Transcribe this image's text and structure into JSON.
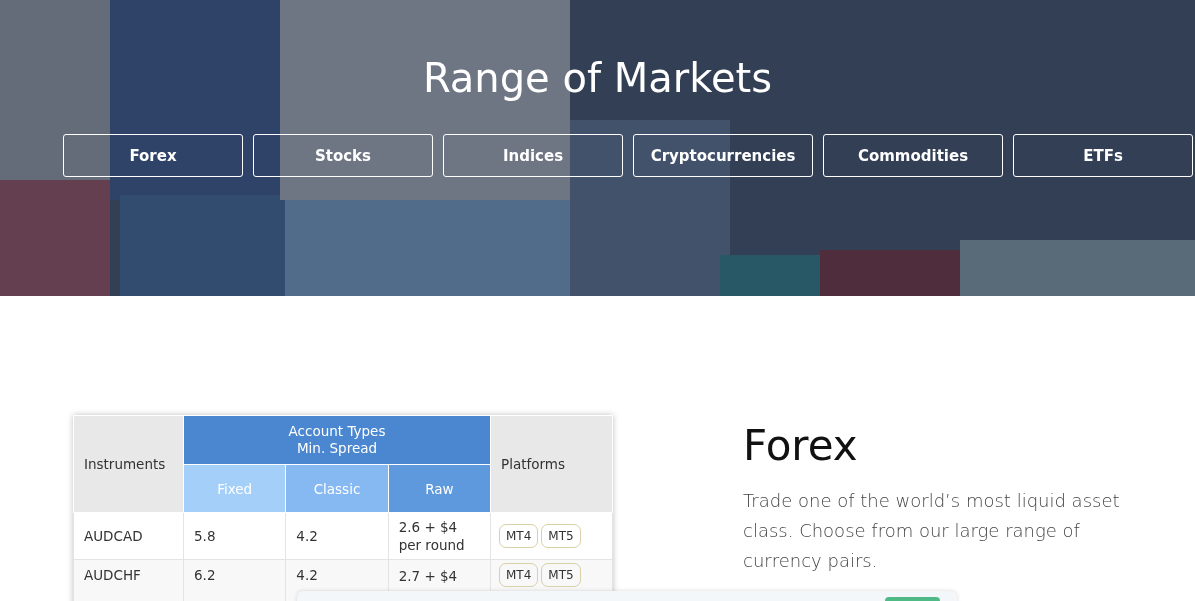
{
  "hero": {
    "kind": "picture",
    "title": "Range of Markets",
    "tabs": [
      {
        "label": "Forex"
      },
      {
        "label": "Stocks"
      },
      {
        "label": "Indices"
      },
      {
        "label": "Cryptocurrencies"
      },
      {
        "label": "Commodities"
      },
      {
        "label": "ETFs"
      }
    ]
  },
  "table": {
    "columns": {
      "instrument": "Instruments",
      "group": "Account Types\nMin. Spread",
      "sub": [
        "Fixed",
        "Classic",
        "Raw"
      ],
      "platforms": "Platforms"
    },
    "rows": [
      {
        "instrument": "AUDCAD",
        "fixed": "5.8",
        "classic": "4.2",
        "raw": "2.6 + $4\nper round",
        "platforms": [
          "MT4",
          "MT5"
        ]
      },
      {
        "instrument": "AUDCHF",
        "fixed": "6.2",
        "classic": "4.2",
        "raw": "2.7 + $4",
        "platforms": [
          "MT4",
          "MT5"
        ]
      }
    ]
  },
  "info": {
    "heading": "Forex",
    "text": "Trade one of the world’s most liquid asset class. Choose from our large range of currency pairs."
  }
}
